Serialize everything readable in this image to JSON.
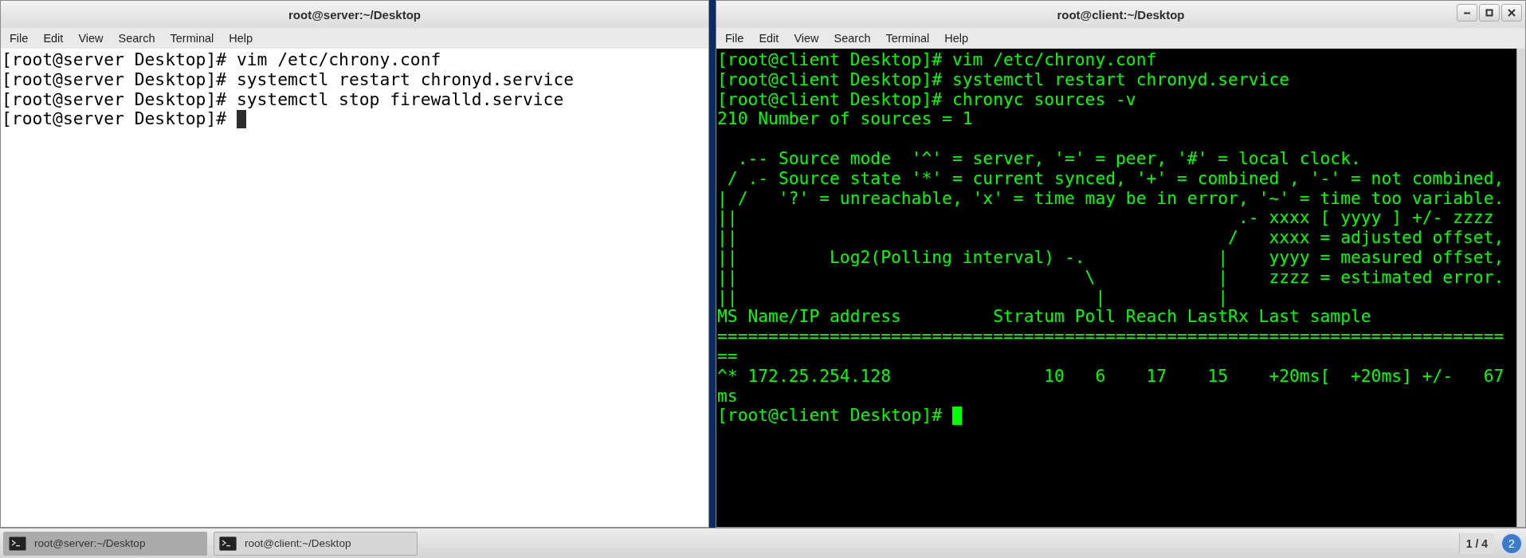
{
  "windows": [
    {
      "title": "root@server:~/Desktop",
      "kind": "light",
      "focused": false,
      "menu": [
        "File",
        "Edit",
        "View",
        "Search",
        "Terminal",
        "Help"
      ],
      "blocks": [
        [
          "[root@server Desktop]# vim /etc/chrony.conf",
          "[root@server Desktop]# systemctl restart chronyd.service",
          "[root@server Desktop]# systemctl stop firewalld.service",
          "[root@server Desktop]# "
        ]
      ]
    },
    {
      "title": "root@client:~/Desktop",
      "kind": "dark",
      "focused": true,
      "menu": [
        "File",
        "Edit",
        "View",
        "Search",
        "Terminal",
        "Help"
      ],
      "blocks": [
        [
          "[root@client Desktop]# vim /etc/chrony.conf",
          "[root@client Desktop]# systemctl restart chronyd.service",
          "[root@client Desktop]# chronyc sources -v",
          "210 Number of sources = 1"
        ],
        [
          "  .-- Source mode  '^' = server, '=' = peer, '#' = local clock.",
          " / .- Source state '*' = current synced, '+' = combined , '-' = not combined,",
          "| /   '?' = unreachable, 'x' = time may be in error, '~' = time too variable.",
          "||                                                 .- xxxx [ yyyy ] +/- zzzz",
          "||                                                /   xxxx = adjusted offset,",
          "||         Log2(Polling interval) -.             |    yyyy = measured offset,",
          "||                                  \\            |    zzzz = estimated error.",
          "||                                   |           |",
          "MS Name/IP address         Stratum Poll Reach LastRx Last sample",
          "=============================================================================",
          "==",
          "^* 172.25.254.128               10   6    17    15    +20ms[  +20ms] +/-   67",
          "ms",
          "[root@client Desktop]# "
        ]
      ]
    }
  ],
  "taskbar": {
    "items": [
      {
        "label": "root@server:~/Desktop",
        "selected": true
      },
      {
        "label": "root@client:~/Desktop",
        "selected": false
      }
    ],
    "pager": "1 / 4",
    "notifications": "2"
  }
}
